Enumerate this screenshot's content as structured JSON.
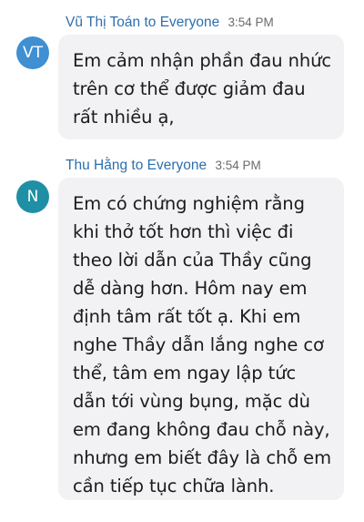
{
  "messages": [
    {
      "sender": "Vũ Thị Toán",
      "to_word": "to",
      "recipient": "Everyone",
      "time": "3:54 PM",
      "avatar_initials": "VT",
      "avatar_color": "#3f8fd2",
      "text": "Em cảm nhận phần đau nhức trên cơ thể được giảm đau rất nhiều ạ,"
    },
    {
      "sender": "Thu Hằng",
      "to_word": "to",
      "recipient": "Everyone",
      "time": "3:54 PM",
      "avatar_initials": "N",
      "avatar_color": "#1f8fa6",
      "text": "Em có chứng nghiệm rằng khi thở tốt hơn thì việc đi theo lời dẫn của Thầy cũng dễ dàng hơn. Hôm nay em định tâm rất tốt ạ. Khi em nghe Thầy dẫn lắng nghe cơ thể, tâm em ngay lập tức dẫn tới vùng bụng, mặc dù em đang không đau chỗ này, nhưng em biết đây là chỗ em cần tiếp tục chữa lành."
    }
  ]
}
